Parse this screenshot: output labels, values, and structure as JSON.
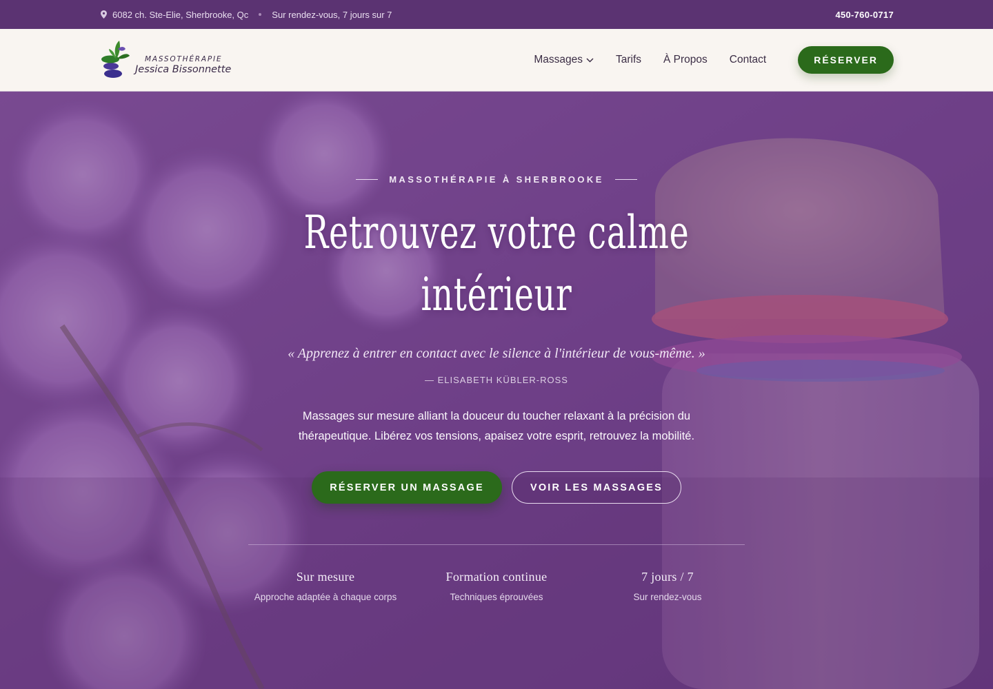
{
  "topbar": {
    "address": "6082 ch. Ste-Elie, Sherbrooke, Qc",
    "hours": "Sur rendez-vous, 7 jours sur 7",
    "phone": "450-760-0717"
  },
  "header": {
    "logo_top": "MASSOTHÉRAPIE",
    "logo_name": "Jessica Bissonnette",
    "nav": [
      {
        "label": "Massages"
      },
      {
        "label": "Tarifs"
      },
      {
        "label": "À Propos"
      },
      {
        "label": "Contact"
      }
    ],
    "reserve_label": "RÉSERVER"
  },
  "hero": {
    "eyebrow": "MASSOTHÉRAPIE À SHERBROOKE",
    "title_line1": "Retrouvez votre calme",
    "title_line2": "intérieur",
    "quote": "« Apprenez à entrer en contact avec le silence à l'intérieur de vous-même. »",
    "author": "— ELISABETH KÜBLER-ROSS",
    "description": "Massages sur mesure alliant la douceur du toucher relaxant à la précision du thérapeutique. Libérez vos tensions, apaisez votre esprit, retrouvez la mobilité.",
    "cta_primary": "RÉSERVER UN MASSAGE",
    "cta_secondary": "VOIR LES MASSAGES",
    "features": [
      {
        "title": "Sur mesure",
        "subtitle": "Approche adaptée à chaque corps"
      },
      {
        "title": "Formation continue",
        "subtitle": "Techniques éprouvées"
      },
      {
        "title": "7 jours / 7",
        "subtitle": "Sur rendez-vous"
      }
    ]
  },
  "colors": {
    "topbar": "#5b3372",
    "header_bg": "#f9f5f1",
    "accent_green": "#2b6a1b",
    "hero_overlay": "#6a3f80"
  },
  "icons": [
    "map-pin-icon",
    "chevron-down-icon",
    "lotus-stones-logo"
  ]
}
